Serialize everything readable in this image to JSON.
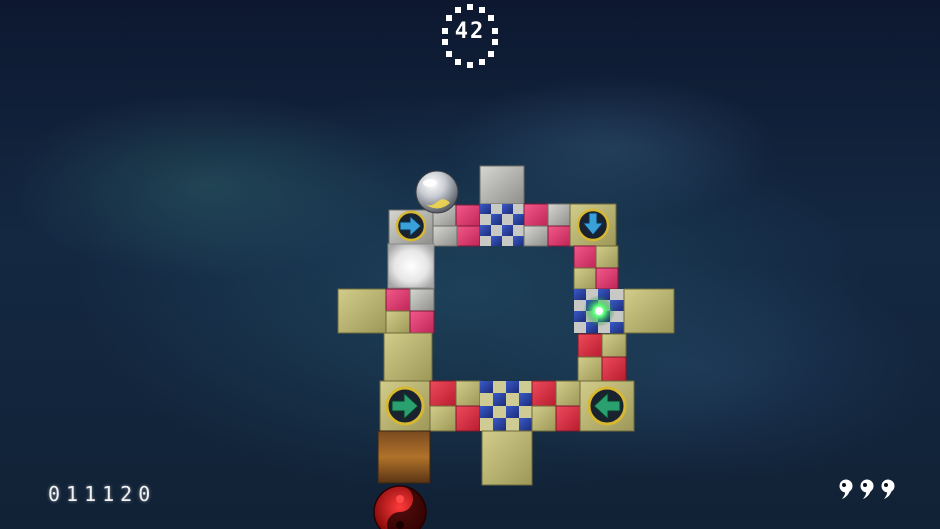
{
  "hud": {
    "timer": "42",
    "score": "011120",
    "lives": 3
  },
  "colors": {
    "tile_yellow": "#b9b26e",
    "tile_grey": "#b4b4b0",
    "tile_pink": "#e03a6e",
    "tile_red": "#d02a40",
    "tile_blue": "#283f9a",
    "arrow_blue": "#3aa0d8",
    "arrow_green": "#2aa070",
    "gem_green": "#3cff6a"
  },
  "icons": {
    "ball": "yin-yang-marble",
    "exit": "yin-yang-red-exit",
    "arrows": [
      "arrow-right-blue",
      "arrow-down-blue",
      "arrow-right-green",
      "arrow-left-green"
    ],
    "gem": "green-gem",
    "lives": "ball-life"
  }
}
